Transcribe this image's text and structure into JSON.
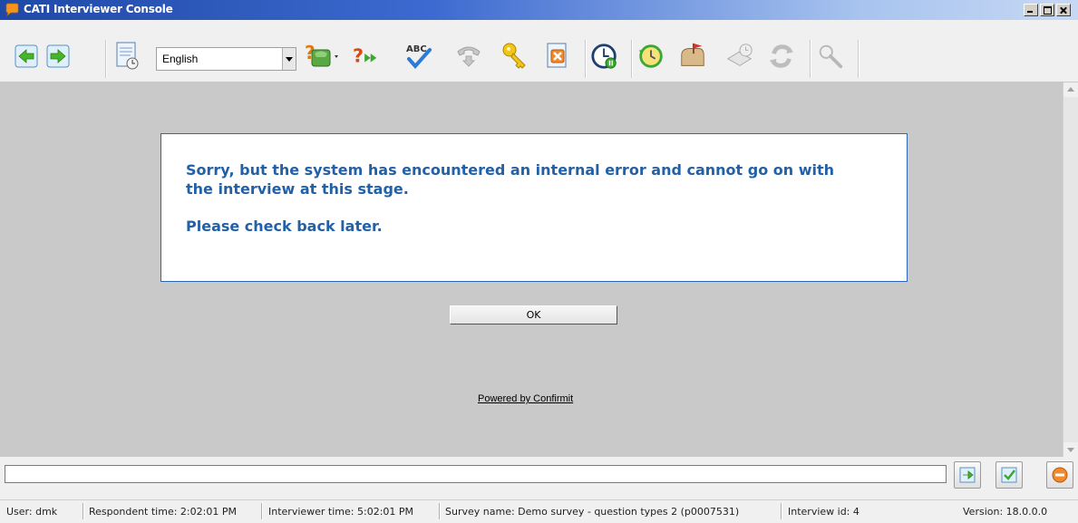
{
  "window": {
    "title": "CATI Interviewer Console"
  },
  "toolbar": {
    "language": "English",
    "buttons": [
      {
        "name": "back",
        "icon": "arrow-left-icon"
      },
      {
        "name": "forward",
        "icon": "arrow-right-icon"
      },
      {
        "name": "schedule-document",
        "icon": "document-clock-icon"
      },
      {
        "name": "help-call",
        "icon": "question-phone-icon"
      },
      {
        "name": "skip",
        "icon": "question-forward-icon"
      },
      {
        "name": "spellcheck",
        "icon": "abc-check-icon",
        "text": "ABC"
      },
      {
        "name": "hang-up",
        "icon": "phone-icon"
      },
      {
        "name": "key",
        "icon": "key-icon"
      },
      {
        "name": "cancel-document",
        "icon": "document-x-icon"
      },
      {
        "name": "timer",
        "icon": "clock-icon"
      },
      {
        "name": "callback",
        "icon": "clock-arrow-icon"
      },
      {
        "name": "mail",
        "icon": "mailbox-icon"
      },
      {
        "name": "appointment-book",
        "icon": "book-clock-icon"
      },
      {
        "name": "refresh",
        "icon": "refresh-icon"
      },
      {
        "name": "search",
        "icon": "magnifier-icon"
      }
    ]
  },
  "dialog": {
    "line1": "Sorry, but the system has encountered an internal error and cannot go on with",
    "line2": "the interview at this stage.",
    "line3": "Please check back later.",
    "ok_label": "OK"
  },
  "footer": {
    "powered_by": "Powered by Confirmit"
  },
  "statusbar": {
    "user": "User:  dmk",
    "respondent_time": "Respondent time:  2:02:01 PM",
    "interviewer_time": "Interviewer time:  5:02:01 PM",
    "survey_name": "Survey name:  Demo survey - question types 2 (p0007531)",
    "interview_id": "Interview id:  4",
    "version": "Version:  18.0.0.0"
  },
  "colors": {
    "error_text": "#2260a8",
    "titlebar": "#1f49a6"
  }
}
